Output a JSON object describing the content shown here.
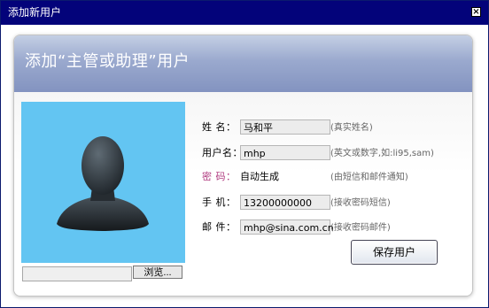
{
  "window": {
    "title": "添加新用户"
  },
  "dialog": {
    "heading": "添加“主管或助理”用户"
  },
  "photo": {
    "browse_label": "浏览..."
  },
  "form": {
    "name": {
      "label": "姓    名：",
      "value": "马和平",
      "hint": "(真实姓名)"
    },
    "username": {
      "label": "用户名：",
      "value": "mhp",
      "hint": "(英文或数字,如:li95,sam)"
    },
    "password": {
      "label": "密    码：",
      "value": "自动生成",
      "hint": "(由短信和邮件通知)"
    },
    "phone": {
      "label": "手    机：",
      "value": "13200000000",
      "hint": "(接收密码短信)"
    },
    "email": {
      "label": "邮    件：",
      "value": "mhp@sina.com.cn",
      "hint": "(接收密码邮件)"
    }
  },
  "actions": {
    "save_label": "保存用户"
  },
  "colors": {
    "titlebar": "#03037a",
    "header": "#8393c0",
    "photo_bg": "#63c5f2",
    "password_label": "#b03a7f"
  }
}
